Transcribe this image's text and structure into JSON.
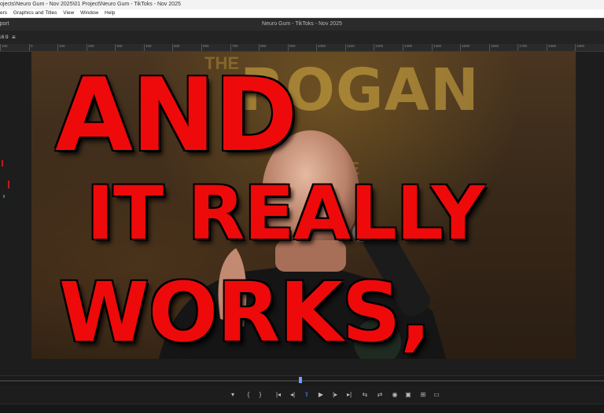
{
  "window": {
    "title": "ojects\\Neuro Gum - Nov 2025\\01 Project\\Neuro Gum - TikToks - Nov 2025"
  },
  "menu": {
    "items": [
      "ers",
      "Graphics and Titles",
      "View",
      "Window",
      "Help"
    ]
  },
  "panel": {
    "left_label": "xport",
    "monitor_title": "Neuro Gum - TikToks - Nov 2025"
  },
  "viewer": {
    "aspect_ratio": "16:9",
    "ruler_ticks": [
      "100",
      "0",
      "100",
      "200",
      "300",
      "400",
      "500",
      "600",
      "700",
      "800",
      "900",
      "1000",
      "1100",
      "1200",
      "1300",
      "1400",
      "1500",
      "1600",
      "1700",
      "1800",
      "1900"
    ],
    "sign_text": "ROGAN",
    "sign_small_text": "THE",
    "sign_experience_text": "ENCE",
    "overlay_lines": [
      "AND",
      "IT REALLY",
      "WORKS,"
    ]
  },
  "playback": {
    "buttons": [
      "marker-icon",
      "in-point-icon",
      "out-point-icon",
      "go-to-in-icon",
      "step-back-icon",
      "lift-icon",
      "play-icon",
      "step-forward-icon",
      "go-to-out-icon",
      "insert-icon",
      "overwrite-icon",
      "export-frame-icon",
      "compare-icon",
      "safe-margins-icon",
      "settings-icon"
    ]
  },
  "colors": {
    "accent": "#4f8dff",
    "overlay_text": "#ee0a0a"
  }
}
